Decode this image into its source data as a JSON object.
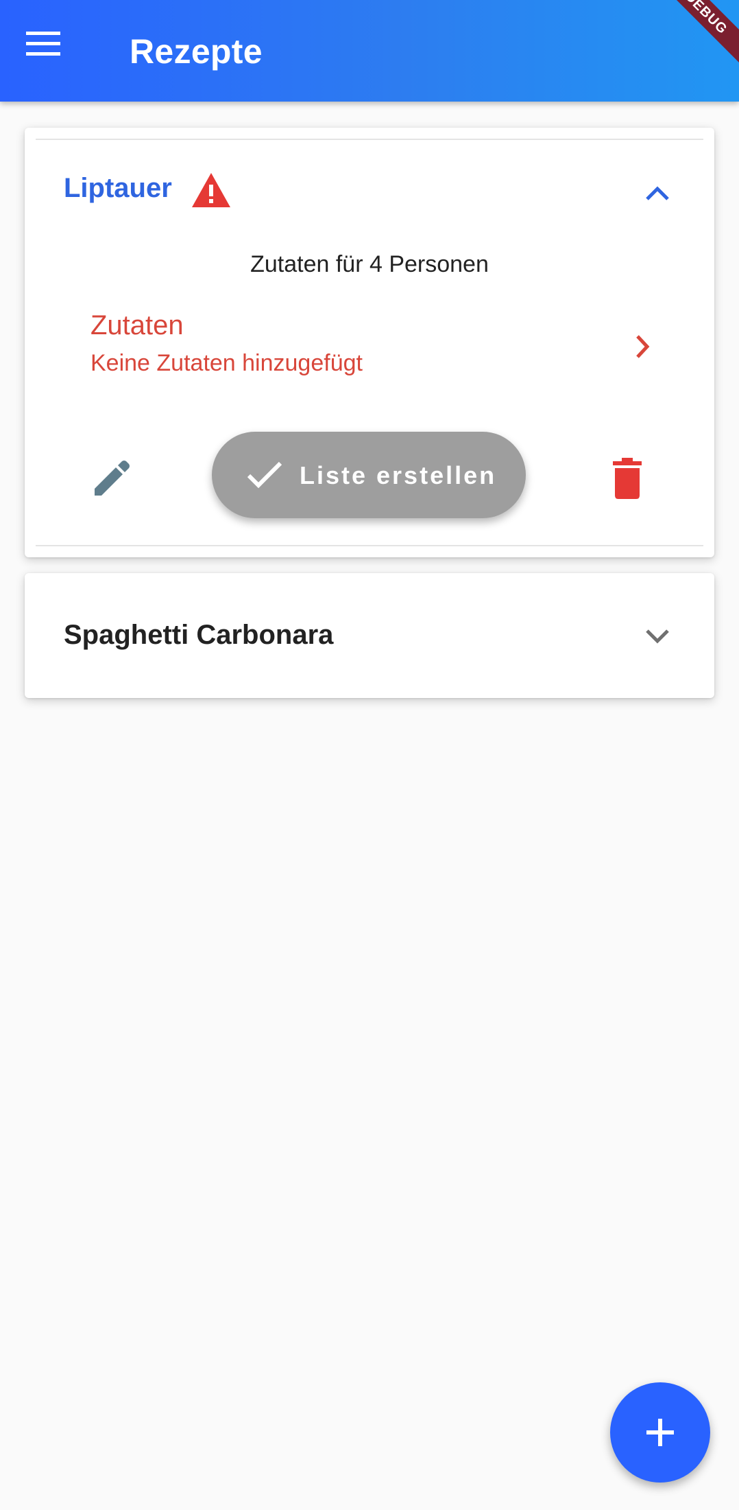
{
  "appbar": {
    "title": "Rezepte",
    "menu_icon": "menu-icon",
    "debug_banner": "DEBUG"
  },
  "recipes": [
    {
      "title": "Liptauer",
      "expanded": true,
      "warning_icon": "warning-icon",
      "servings_text": "Zutaten für 4 Personen",
      "ingredients": {
        "title": "Zutaten",
        "subtitle": "Keine Zutaten hinzugefügt",
        "arrow_icon": "chevron-right-icon"
      },
      "actions": {
        "edit_icon": "pencil-icon",
        "create_list_label": "Liste erstellen",
        "create_list_icon": "check-icon",
        "delete_icon": "trash-icon"
      }
    },
    {
      "title": "Spaghetti Carbonara",
      "expanded": false
    }
  ],
  "fab": {
    "icon": "plus-icon"
  },
  "colors": {
    "primary": "#2962ff",
    "title_accent": "#2f65e0",
    "warning": "#e53935",
    "ingredient_text": "#d8463a",
    "edit_icon": "#5f7d8c",
    "list_button": "#9e9e9e"
  }
}
